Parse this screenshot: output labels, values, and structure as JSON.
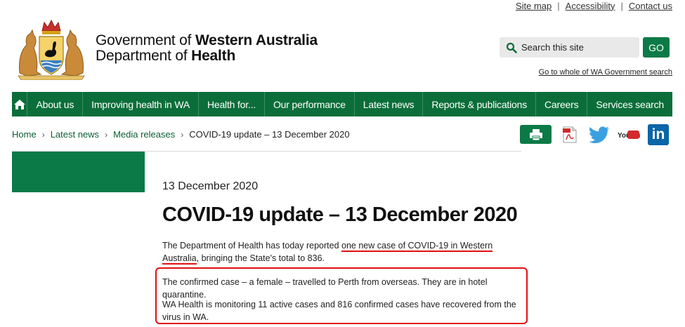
{
  "utility_links": [
    "Site map",
    "Accessibility",
    "Contact us"
  ],
  "utility_separator": "|",
  "brand": {
    "line1_prefix": "Government of ",
    "line1_bold": "Western Australia",
    "line2_prefix": "Department of ",
    "line2_bold": "Health"
  },
  "search": {
    "placeholder": "Search this site",
    "button_label": "GO",
    "wa_link": "Go to whole of WA Government search"
  },
  "nav": {
    "items": [
      "About us",
      "Improving health in WA",
      "Health for...",
      "Our performance",
      "Latest news",
      "Reports & publications",
      "Careers",
      "Services search"
    ]
  },
  "breadcrumb": [
    "Home",
    "Latest news",
    "Media releases",
    "COVID-19 update – 13 December 2020"
  ],
  "share_icons": [
    "print-icon",
    "pdf-icon",
    "twitter-icon",
    "youtube-icon",
    "linkedin-icon"
  ],
  "social": {
    "youtube_text": "You Tube",
    "linkedin_text": "in"
  },
  "article": {
    "date": "13 December 2020",
    "title": "COVID-19 update – 13 December 2020",
    "p1_before": "The Department of Health has today reported ",
    "p1_highlight": "one new case of COVID-19 in Western Australia",
    "p1_after": ", bringing the State's total to 836.",
    "p2": "The confirmed case – a female – travelled to Perth from overseas. They are in hotel quarantine.",
    "p3": "WA Health is monitoring 11 active cases and 816 confirmed cases have recovered from the virus in WA."
  },
  "colors": {
    "nav_green": "#0b6e3a",
    "button_green": "#0b7a46",
    "annotation_red": "#e01010"
  }
}
